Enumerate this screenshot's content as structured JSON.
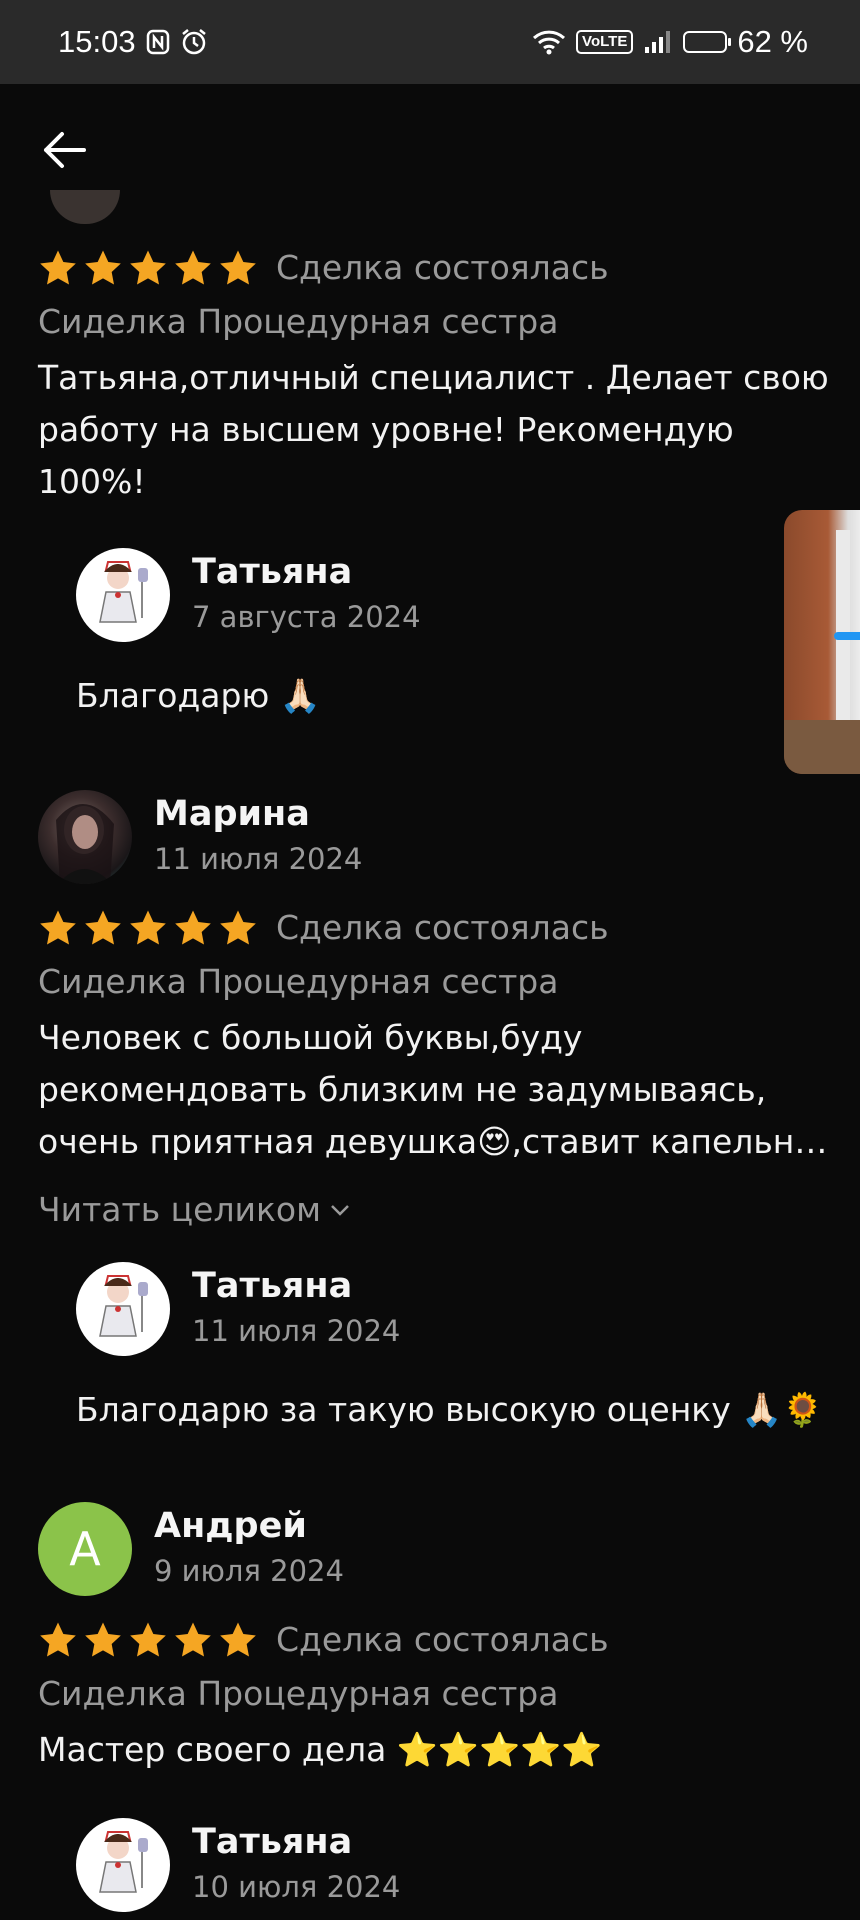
{
  "status_bar": {
    "time": "15:03",
    "battery": "62 %",
    "network": "VoLTE"
  },
  "reviews": [
    {
      "deal": "Сделка состоялась",
      "category": "Сиделка Процедурная сестра",
      "text": "Татьяна,отличный специалист . Делает свою работу на высшем уровне! Рекомендую 100%!",
      "reply": {
        "name": "Татьяна",
        "date": "7 августа 2024",
        "text": "Благодарю 🙏🏻"
      }
    },
    {
      "name": "Марина",
      "date": "11 июля 2024",
      "deal": "Сделка состоялась",
      "category": "Сиделка Процедурная сестра",
      "text": "Человек с большой буквы,буду рекомендовать близким не задумываясь, очень приятная девушка😍,ставит капельн…",
      "read_more": "Читать целиком",
      "reply": {
        "name": "Татьяна",
        "date": "11 июля 2024",
        "text": "Благодарю за такую высокую оценку 🙏🏻🌻"
      }
    },
    {
      "name": "Андрей",
      "avatar_letter": "А",
      "date": "9 июля 2024",
      "deal": "Сделка состоялась",
      "category": "Сиделка Процедурная сестра",
      "text": "Мастер своего дела ⭐⭐⭐⭐⭐",
      "reply": {
        "name": "Татьяна",
        "date": "10 июля 2024"
      }
    }
  ],
  "colors": {
    "star": "#f5a623",
    "letter_avatar": "#8bc34a",
    "background": "#0a0a0a"
  }
}
